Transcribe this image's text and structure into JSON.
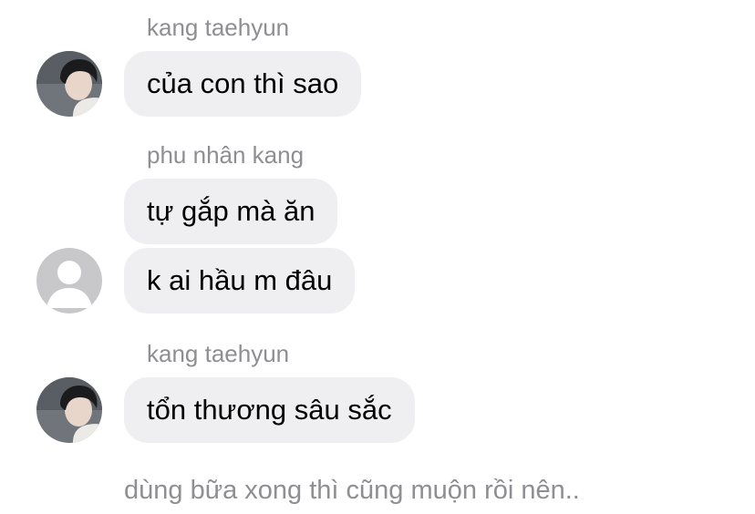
{
  "messages": [
    {
      "sender": "kang taehyun",
      "avatar": "photo-avatar",
      "bubbles": [
        "của con thì sao"
      ]
    },
    {
      "sender": "phu nhân kang",
      "avatar": "default-person-avatar",
      "bubbles": [
        "tự gắp mà ăn",
        "k ai hầu m đâu"
      ]
    },
    {
      "sender": "kang taehyun",
      "avatar": "photo-avatar",
      "bubbles": [
        "tổn thương sâu sắc"
      ]
    }
  ],
  "footer_text": "dùng bữa xong thì cũng muộn rồi nên..",
  "colors": {
    "bubble_background": "#efeff1",
    "sender_text": "#8e8e93",
    "message_text": "#000000",
    "background": "#ffffff"
  }
}
